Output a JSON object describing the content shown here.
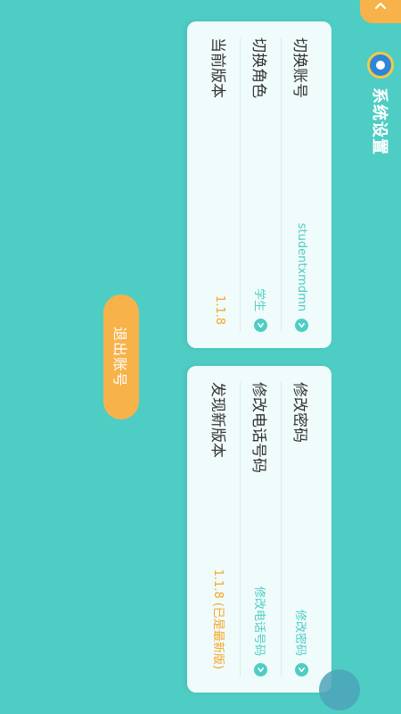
{
  "header": {
    "title": "系统设置"
  },
  "account_card": {
    "rows": [
      {
        "label": "切换账号",
        "value": "studentxmdmn",
        "has_chevron": true
      },
      {
        "label": "切换角色",
        "value": "学生",
        "has_chevron": true
      },
      {
        "label": "当前版本",
        "value": "1.1.8",
        "has_chevron": false
      }
    ]
  },
  "security_card": {
    "rows": [
      {
        "label": "修改密码",
        "value": "修改密码",
        "has_chevron": true
      },
      {
        "label": "修改电话号码",
        "value": "修改电话号码",
        "has_chevron": true
      },
      {
        "label": "发现新版本",
        "value": "1.1.8 (已是最新版)",
        "has_chevron": false
      }
    ]
  },
  "logout_label": "退出账号",
  "colors": {
    "background": "#4ECDC4",
    "accent_orange": "#F7B24A",
    "accent_teal": "#4ECDC4",
    "card_bg": "#F0FBFB"
  },
  "icons": [
    "chevron-up-icon",
    "gear-icon",
    "chevron-right-icon"
  ]
}
